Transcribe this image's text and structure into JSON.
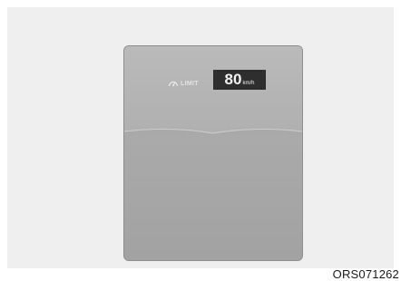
{
  "display": {
    "limit_icon_name": "speed-limit-icon",
    "limit_label": "LIMIT",
    "speed_value": "80",
    "speed_unit": "km/h"
  },
  "caption": {
    "code": "ORS071262"
  },
  "colors": {
    "panel": "#adadad",
    "speed_box": "#2e2e2e",
    "background": "#efefef"
  }
}
